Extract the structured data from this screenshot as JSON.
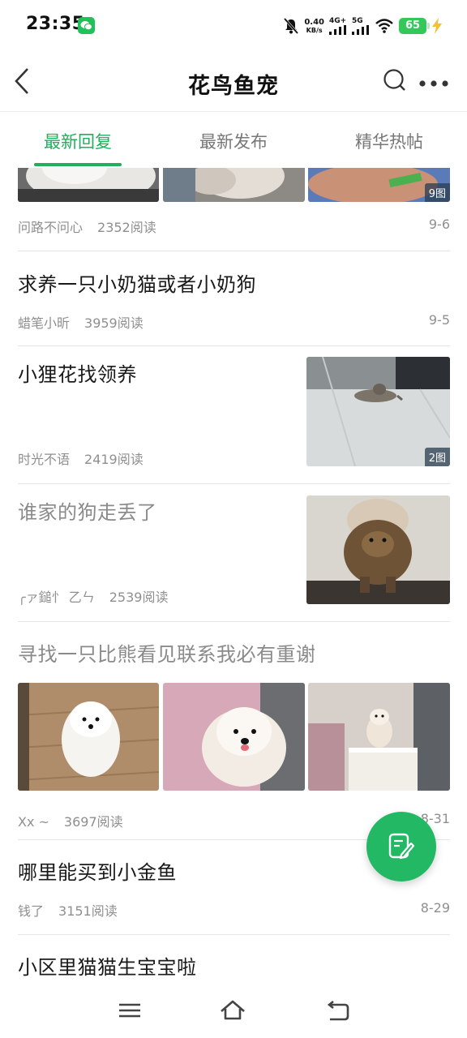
{
  "status_bar": {
    "time": "23:35",
    "net_speed_value": "0.40",
    "net_speed_unit": "KB/s",
    "net_tag_1": "4G+",
    "net_tag_2": "5G",
    "battery": "65"
  },
  "header": {
    "title": "花鸟鱼宠"
  },
  "tabs": [
    {
      "label": "最新回复"
    },
    {
      "label": "最新发布"
    },
    {
      "label": "精华热帖"
    }
  ],
  "posts": [
    {
      "title": "",
      "author": "问路不问心",
      "reads": "2352阅读",
      "date": "9-6",
      "image_count": "9图"
    },
    {
      "title": "求养一只小奶猫或者小奶狗",
      "author": "蜡笔小昕",
      "reads": "3959阅读",
      "date": "9-5"
    },
    {
      "title": "小狸花找领养",
      "author": "时光不语",
      "reads": "2419阅读",
      "date": "",
      "image_count": "2图"
    },
    {
      "title": "谁家的狗走丢了",
      "author": "╭ァ鎚忄 乙ㄣ",
      "reads": "2539阅读",
      "date": ""
    },
    {
      "title": "寻找一只比熊看见联系我必有重谢",
      "author": "Xx ~",
      "reads": "3697阅读",
      "date": "8-31"
    },
    {
      "title": "哪里能买到小金鱼",
      "author": "钱了",
      "reads": "3151阅读",
      "date": "8-29"
    },
    {
      "title": "小区里猫猫生宝宝啦"
    }
  ],
  "colors": {
    "accent": "#20b05b",
    "fab": "#22b864",
    "text_primary": "#1a1a1a",
    "text_secondary": "#8f8f8f"
  }
}
